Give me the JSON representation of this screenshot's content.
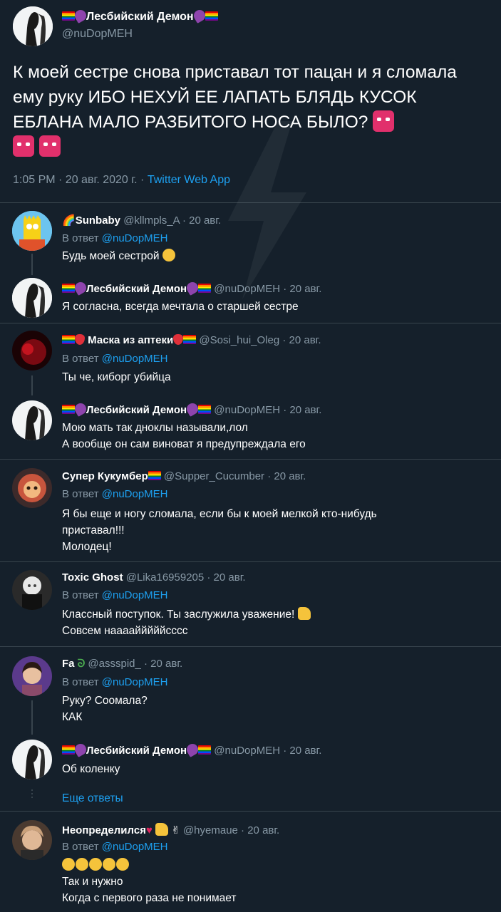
{
  "main": {
    "name": "Лесбийский Демон",
    "handle": "@nuDopMEH",
    "text": "К моей сестре снова приставал тот пацан и я сломала ему руку ИБО НЕХУЙ ЕЕ ЛАПАТЬ БЛЯДЬ КУСОК ЕБЛАНА МАЛО РАЗБИТОГО НОСА БЫЛО?",
    "time": "1:05 PM · 20 авг. 2020 г. · ",
    "source": "Twitter Web App"
  },
  "reply_prefix": "В ответ ",
  "replies": [
    {
      "name": "Sunbaby",
      "meta": "@kllmpls_A · 20 авг.",
      "reply_to": "@nuDopMEH",
      "lines": [
        "Будь моей сестрой"
      ]
    },
    {
      "name": "Лесбийский Демон",
      "meta": "@nuDopMEH · 20 авг.",
      "lines": [
        "Я согласна, всегда мечтала о старшей сестре"
      ]
    },
    {
      "name": "Маска из аптеки",
      "meta": "@Sosi_hui_Oleg · 20 авг.",
      "reply_to": "@nuDopMEH",
      "lines": [
        "Ты че, киборг убийца"
      ]
    },
    {
      "name": "Лесбийский Демон",
      "meta": "@nuDopMEH · 20 авг.",
      "lines": [
        "Мою мать так дноклы называли,лол",
        "А вообще он сам виноват я предупреждала его"
      ]
    },
    {
      "name": "Супер Кукумбер",
      "meta": "@Supper_Cucumber · 20 авг.",
      "reply_to": "@nuDopMEH",
      "lines": [
        "Я бы еще и ногу сломала, если бы к моей мелкой кто-нибудь",
        "приставал!!!",
        "Молодец!"
      ]
    },
    {
      "name": "Toxic Ghost",
      "meta": "@Lika16959205 · 20 авг.",
      "reply_to": "@nuDopMEH",
      "lines": [
        "Классный поступок. Ты заслужила уважение!",
        "Совсем наааайййййсссс"
      ]
    },
    {
      "name": "Fa",
      "meta": "@assspid_ · 20 авг.",
      "reply_to": "@nuDopMEH",
      "lines": [
        "Руку? Соомала?",
        "КАК"
      ]
    },
    {
      "name": "Лесбийский Демон",
      "meta": "@nuDopMEH · 20 авг.",
      "lines": [
        "Об коленку"
      ]
    },
    {
      "name": "Неопределился",
      "meta": "@hyemaue · 20 авг.",
      "reply_to": "@nuDopMEH",
      "lines": [
        "Так и нужно",
        "Когда с первого раза не понимает"
      ]
    }
  ],
  "more_replies": "Еще ответы",
  "colors": {
    "background": "#15202b",
    "muted": "#8899a6",
    "link": "#1da1f2",
    "divider": "#38444d"
  }
}
